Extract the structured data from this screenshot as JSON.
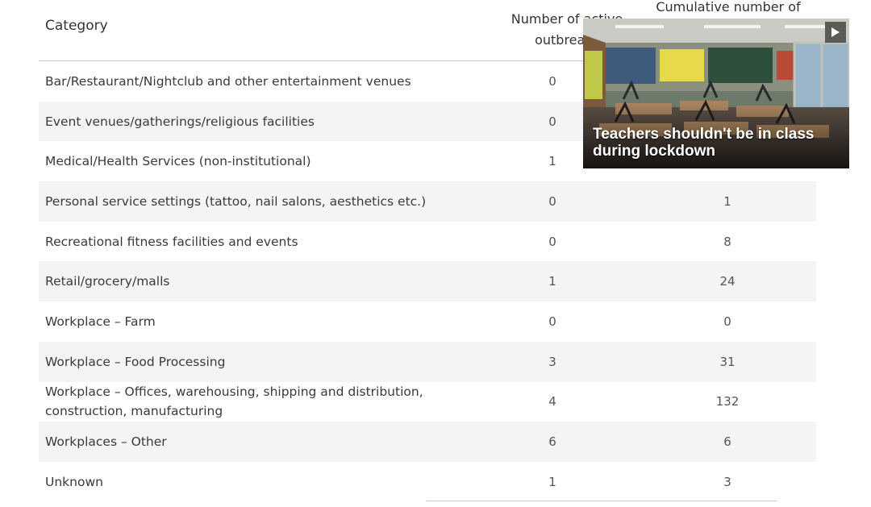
{
  "table": {
    "headers": {
      "category": "Category",
      "active": "Number of active\noutbreaks",
      "cumulative": "Cumulative number of"
    },
    "rows": [
      {
        "category": "Bar/Restaurant/Nightclub and other entertainment venues",
        "active": "0",
        "cumulative": ""
      },
      {
        "category": "Event venues/gatherings/religious facilities",
        "active": "0",
        "cumulative": ""
      },
      {
        "category": "Medical/Health Services (non-institutional)",
        "active": "1",
        "cumulative": ""
      },
      {
        "category": "Personal service settings (tattoo, nail salons, aesthetics etc.)",
        "active": "0",
        "cumulative": "1"
      },
      {
        "category": "Recreational fitness facilities and events",
        "active": "0",
        "cumulative": "8"
      },
      {
        "category": "Retail/grocery/malls",
        "active": "1",
        "cumulative": "24"
      },
      {
        "category": "Workplace – Farm",
        "active": "0",
        "cumulative": "0"
      },
      {
        "category": "Workplace – Food Processing",
        "active": "3",
        "cumulative": "31"
      },
      {
        "category": "Workplace – Offices, warehousing, shipping and distribution, construction, manufacturing",
        "active": "4",
        "cumulative": "132"
      },
      {
        "category": "Workplaces – Other",
        "active": "6",
        "cumulative": "6"
      },
      {
        "category": "Unknown",
        "active": "1",
        "cumulative": "3"
      }
    ]
  },
  "video": {
    "caption": "Teachers shouldn't be in class during lockdown",
    "play_icon": "play-icon"
  },
  "colors": {
    "row_alt": "#f4f4f4",
    "rule": "#c8c8c8",
    "text": "#3a3a3a"
  }
}
